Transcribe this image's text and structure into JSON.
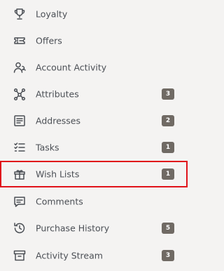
{
  "nav": {
    "items": [
      {
        "label": "Loyalty",
        "icon": "trophy-icon",
        "badge": ""
      },
      {
        "label": "Offers",
        "icon": "ticket-icon",
        "badge": ""
      },
      {
        "label": "Account Activity",
        "icon": "user-activity-icon",
        "badge": ""
      },
      {
        "label": "Attributes",
        "icon": "network-icon",
        "badge": "3"
      },
      {
        "label": "Addresses",
        "icon": "address-book-icon",
        "badge": "2"
      },
      {
        "label": "Tasks",
        "icon": "checklist-icon",
        "badge": "1"
      },
      {
        "label": "Wish Lists",
        "icon": "gift-icon",
        "badge": "1",
        "selected": true
      },
      {
        "label": "Comments",
        "icon": "comment-icon",
        "badge": ""
      },
      {
        "label": "Purchase History",
        "icon": "history-icon",
        "badge": "5"
      },
      {
        "label": "Activity Stream",
        "icon": "archive-icon",
        "badge": "3"
      }
    ]
  },
  "colors": {
    "background": "#f4f3f2",
    "text": "#4b4f55",
    "badge": "#706a64",
    "selected_outline": "#e0121a"
  }
}
